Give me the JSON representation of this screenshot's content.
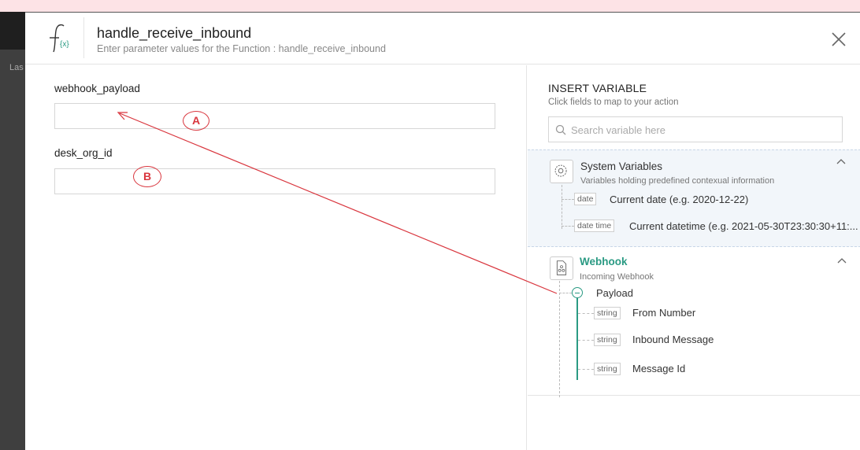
{
  "backdrop": {
    "partial_text": "Las"
  },
  "header": {
    "title": "handle_receive_inbound",
    "subtitle": "Enter parameter values for the Function : handle_receive_inbound"
  },
  "fields": [
    {
      "label": "webhook_payload",
      "value": ""
    },
    {
      "label": "desk_org_id",
      "value": ""
    }
  ],
  "insert_variable": {
    "title": "INSERT VARIABLE",
    "subtitle": "Click fields to map to your action",
    "search_placeholder": "Search variable here"
  },
  "system_variables": {
    "icon": "gear-icon",
    "title": "System Variables",
    "subtitle": "Variables holding predefined contexual information",
    "items": [
      {
        "tag": "date",
        "label": "Current date (e.g. 2020-12-22)"
      },
      {
        "tag": "date time",
        "label": "Current datetime (e.g. 2021-05-30T23:30:30+11:..."
      }
    ]
  },
  "webhook": {
    "icon": "webhook-icon",
    "title": "Webhook",
    "subtitle": "Incoming Webhook",
    "group_label": "Payload",
    "items": [
      {
        "tag": "string",
        "label": "From Number"
      },
      {
        "tag": "string",
        "label": "Inbound Message"
      },
      {
        "tag": "string",
        "label": "Message Id"
      }
    ]
  },
  "annotations": {
    "marker_a": "A",
    "marker_b": "B"
  },
  "colors": {
    "accent_green": "#2a9a83",
    "annotation_red": "#d9363e",
    "backdrop_pink": "#fde3e6"
  }
}
